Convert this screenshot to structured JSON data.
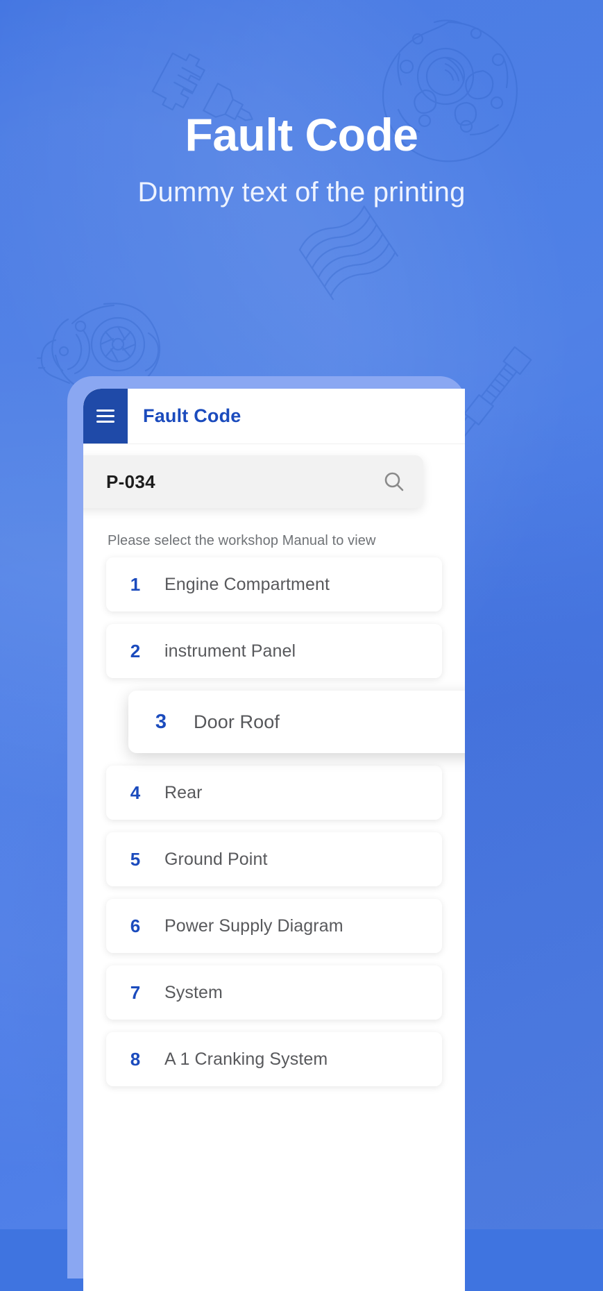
{
  "hero": {
    "title": "Fault Code",
    "subtitle": "Dummy text of the printing"
  },
  "colors": {
    "background_blue": "#3f74e0",
    "frame_blue": "#8aa7f2",
    "menu_button_blue": "#1f4aa8",
    "accent_blue": "#1b4bbd",
    "search_background": "#f2f2f2",
    "label_gray": "#58595c"
  },
  "appbar": {
    "menu_icon": "hamburger-menu-icon",
    "title": "Fault Code"
  },
  "search": {
    "value": "P-034",
    "placeholder": "P-034",
    "icon": "search-icon"
  },
  "list": {
    "hint": "Please select the workshop Manual to view",
    "items": [
      {
        "number": "1",
        "label": "Engine Compartment",
        "active": false
      },
      {
        "number": "2",
        "label": "instrument Panel",
        "active": false
      },
      {
        "number": "3",
        "label": "Door Roof",
        "active": true
      },
      {
        "number": "4",
        "label": "Rear",
        "active": false
      },
      {
        "number": "5",
        "label": "Ground Point",
        "active": false
      },
      {
        "number": "6",
        "label": "Power Supply Diagram",
        "active": false
      },
      {
        "number": "7",
        "label": "System",
        "active": false
      },
      {
        "number": "8",
        "label": "A 1 Cranking System",
        "active": false
      }
    ]
  },
  "decorations": [
    {
      "name": "alternator-housing-watermark"
    },
    {
      "name": "spark-plug-watermark"
    },
    {
      "name": "coil-spring-watermark"
    },
    {
      "name": "turbocharger-watermark"
    },
    {
      "name": "shock-absorber-watermark"
    }
  ]
}
